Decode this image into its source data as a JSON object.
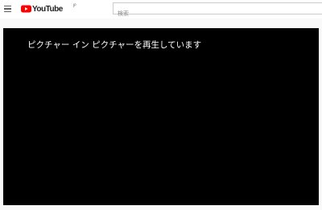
{
  "header": {
    "logo_text": "YouTube",
    "logo_region": "JP",
    "brand_color": "#ff0000",
    "search": {
      "placeholder": "検索",
      "value": ""
    }
  },
  "player": {
    "message": "ピクチャー イン ピクチャーを再生しています"
  }
}
